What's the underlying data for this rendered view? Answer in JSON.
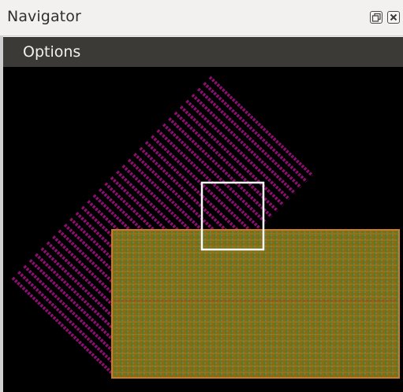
{
  "window": {
    "title": "Navigator",
    "float_icon": "restore-icon",
    "close_icon": "close-icon"
  },
  "menu": {
    "options_label": "Options"
  },
  "navigator": {
    "background_color": "#000000",
    "rotated_layer_color": "#8b0f6e",
    "grid_fill_color": "#8a6a12",
    "grid_border_color": "#c87d2a",
    "grid_dot_color": "#3aa6b0",
    "grid_line_color": "#4b7f2a",
    "grid_red_line_color": "#c0392b",
    "viewport_color": "#ffffff"
  }
}
